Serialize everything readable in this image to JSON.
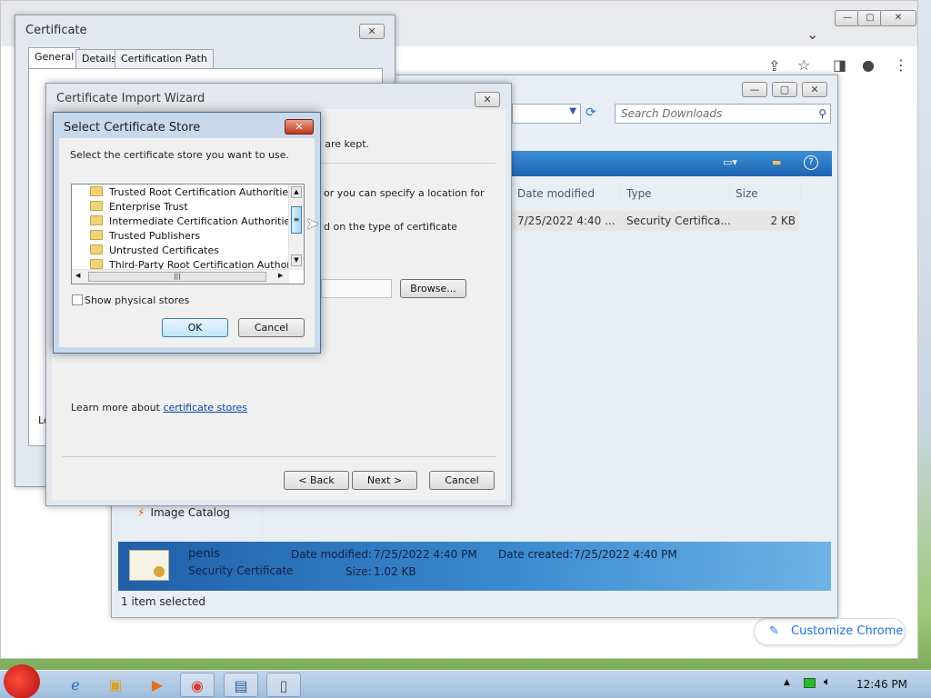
{
  "chrome": {
    "customize_label": "Customize Chrome",
    "pencil_icon": "✎"
  },
  "explorer": {
    "search_placeholder": "Search Downloads",
    "columns": [
      "Date modified",
      "Type",
      "Size"
    ],
    "file_row": {
      "date": "7/25/2022 4:40 ...",
      "type": "Security Certifica...",
      "size": "2 KB"
    },
    "sidebar_item": "Image Catalog",
    "details": {
      "name": "penis",
      "type": "Security Certificate",
      "date_modified_label": "Date modified:",
      "date_modified": "7/25/2022 4:40 PM",
      "date_created_label": "Date created:",
      "date_created": "7/25/2022 4:40 PM",
      "size_label": "Size:",
      "size": "1.02 KB"
    },
    "status": "1 item selected"
  },
  "certificate": {
    "title": "Certificate",
    "tabs": [
      "General",
      "Details",
      "Certification Path"
    ],
    "partial_text": "Le"
  },
  "wizard": {
    "title": "Certificate Import Wizard",
    "line1_partial": "s are kept.",
    "line2_partial": "or you can specify a location for",
    "line3_partial": "d on the type of certificate",
    "browse_label": "Browse...",
    "learn_more_prefix": "Learn more about ",
    "learn_more_link": "certificate stores",
    "back_label": "< Back",
    "next_label": "Next >",
    "cancel_label": "Cancel"
  },
  "store_dialog": {
    "title": "Select Certificate Store",
    "instruction": "Select the certificate store you want to use.",
    "items": [
      "Trusted Root Certification Authorities",
      "Enterprise Trust",
      "Intermediate Certification Authorities",
      "Trusted Publishers",
      "Untrusted Certificates",
      "Third-Party Root Certification Authorities"
    ],
    "show_physical_label": "Show physical stores",
    "ok_label": "OK",
    "cancel_label": "Cancel"
  },
  "taskbar": {
    "clock": "12:46 PM"
  }
}
